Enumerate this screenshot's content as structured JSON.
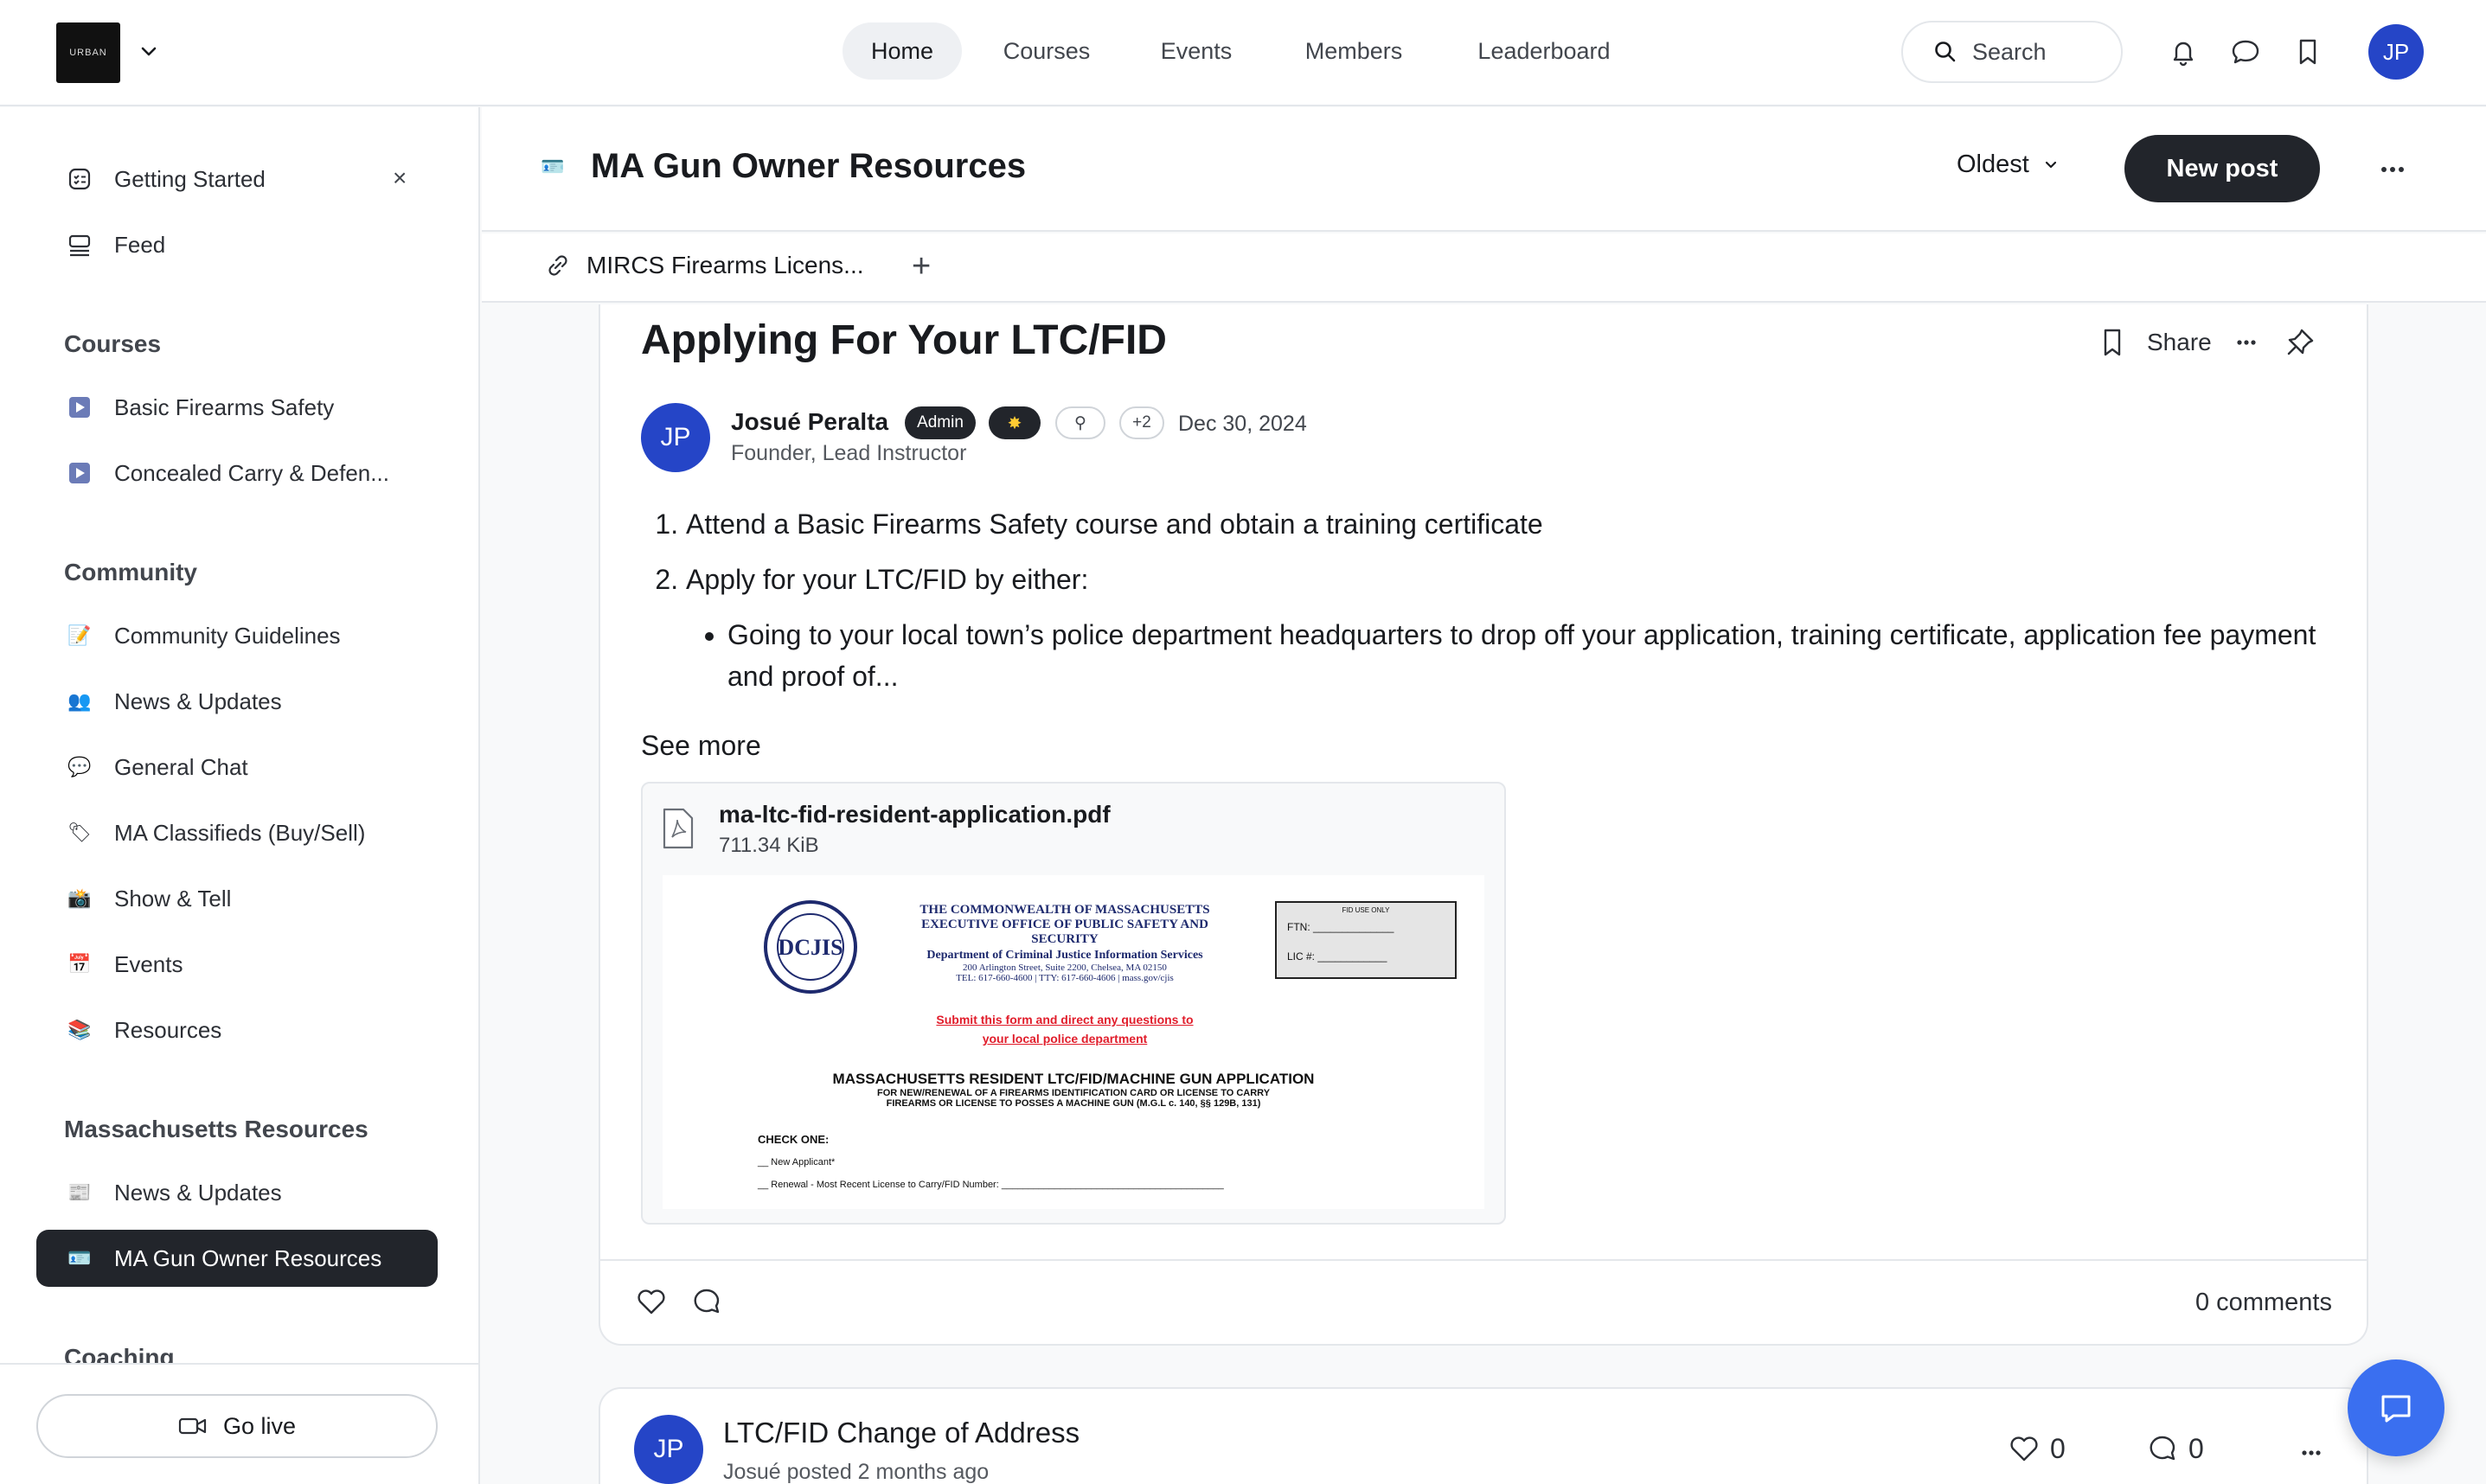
{
  "brand": {
    "logo_text": "URBAN"
  },
  "topnav": {
    "tabs": [
      "Home",
      "Courses",
      "Events",
      "Members",
      "Leaderboard"
    ],
    "active_tab": "Home",
    "search_label": "Search",
    "avatar_initials": "JP"
  },
  "sidebar": {
    "top_items": [
      {
        "label": "Getting Started",
        "icon": "checklist-icon"
      },
      {
        "label": "Feed",
        "icon": "feed-icon"
      }
    ],
    "sections": [
      {
        "heading": "Courses",
        "items": [
          {
            "label": "Basic Firearms Safety",
            "icon": "play-icon"
          },
          {
            "label": "Concealed Carry & Defen...",
            "icon": "play-icon"
          }
        ]
      },
      {
        "heading": "Community",
        "items": [
          {
            "label": "Community Guidelines",
            "icon": "memo-emoji"
          },
          {
            "label": "News & Updates",
            "icon": "people-emoji"
          },
          {
            "label": "General Chat",
            "icon": "speech-bubble-emoji"
          },
          {
            "label": "MA Classifieds (Buy/Sell)",
            "icon": "tag-emoji"
          },
          {
            "label": "Show & Tell",
            "icon": "camera-emoji"
          },
          {
            "label": "Events",
            "icon": "calendar-emoji"
          },
          {
            "label": "Resources",
            "icon": "books-emoji"
          }
        ]
      },
      {
        "heading": "Massachusetts Resources",
        "items": [
          {
            "label": "News & Updates",
            "icon": "newspaper-emoji"
          },
          {
            "label": "MA Gun Owner Resources",
            "icon": "id-card-emoji",
            "active": true
          }
        ]
      },
      {
        "heading": "Coaching",
        "items": []
      }
    ],
    "go_live_label": "Go live"
  },
  "space": {
    "title": "MA Gun Owner Resources",
    "sort_label": "Oldest",
    "new_post_label": "New post",
    "link_label": "MIRCS Firearms Licens..."
  },
  "post": {
    "title": "Applying For Your LTC/FID",
    "share_label": "Share",
    "author": {
      "name": "Josué Peralta",
      "initials": "JP",
      "role": "Founder, Lead Instructor"
    },
    "badges": {
      "admin": "Admin",
      "more": "+2"
    },
    "date": "Dec 30, 2024",
    "body": {
      "step1": "Attend a Basic Firearms Safety course and obtain a training certificate",
      "step2": "Apply for your LTC/FID by either:",
      "bullet1": "Going to your local town’s police department headquarters to drop off your application, training certificate, application fee payment and proof of..."
    },
    "see_more": "See more",
    "attachment": {
      "filename": "ma-ltc-fid-resident-application.pdf",
      "size": "711.34 KiB",
      "preview": {
        "seal_text": "DCJIS",
        "line1": "THE COMMONWEALTH OF MASSACHUSETTS",
        "line2": "EXECUTIVE OFFICE OF PUBLIC SAFETY AND SECURITY",
        "line3": "Department of Criminal Justice Information Services",
        "line4": "200 Arlington Street, Suite 2200, Chelsea, MA 02150",
        "line5": "TEL: 617-660-4600 | TTY: 617-660-4606 | mass.gov/cjis",
        "box_head": "FID USE ONLY",
        "box_ftn": "FTN:",
        "box_lic": "LIC #:",
        "red1": "Submit this form and direct any questions to",
        "red2": "your local police department",
        "form_title": "MASSACHUSETTS RESIDENT LTC/FID/MACHINE GUN APPLICATION",
        "form_sub1": "FOR NEW/RENEWAL OF A FIREARMS IDENTIFICATION CARD OR LICENSE TO CARRY",
        "form_sub2": "FIREARMS OR LICENSE TO POSSES A MACHINE GUN (M.G.L c. 140, §§ 129B, 131)",
        "check_one": "CHECK ONE:",
        "opt1": "New Applicant*",
        "opt2": "Renewal - Most Recent License to Carry/FID Number:"
      }
    },
    "comments_label": "0 comments"
  },
  "post2": {
    "title": "LTC/FID Change of Address",
    "initials": "JP",
    "meta": "Josué posted 2 months ago",
    "likes": "0",
    "comments": "0"
  },
  "colors": {
    "accent": "#2545c7",
    "dark": "#22252b",
    "fab": "#3a6ff0",
    "red_text": "#e11d2b"
  }
}
